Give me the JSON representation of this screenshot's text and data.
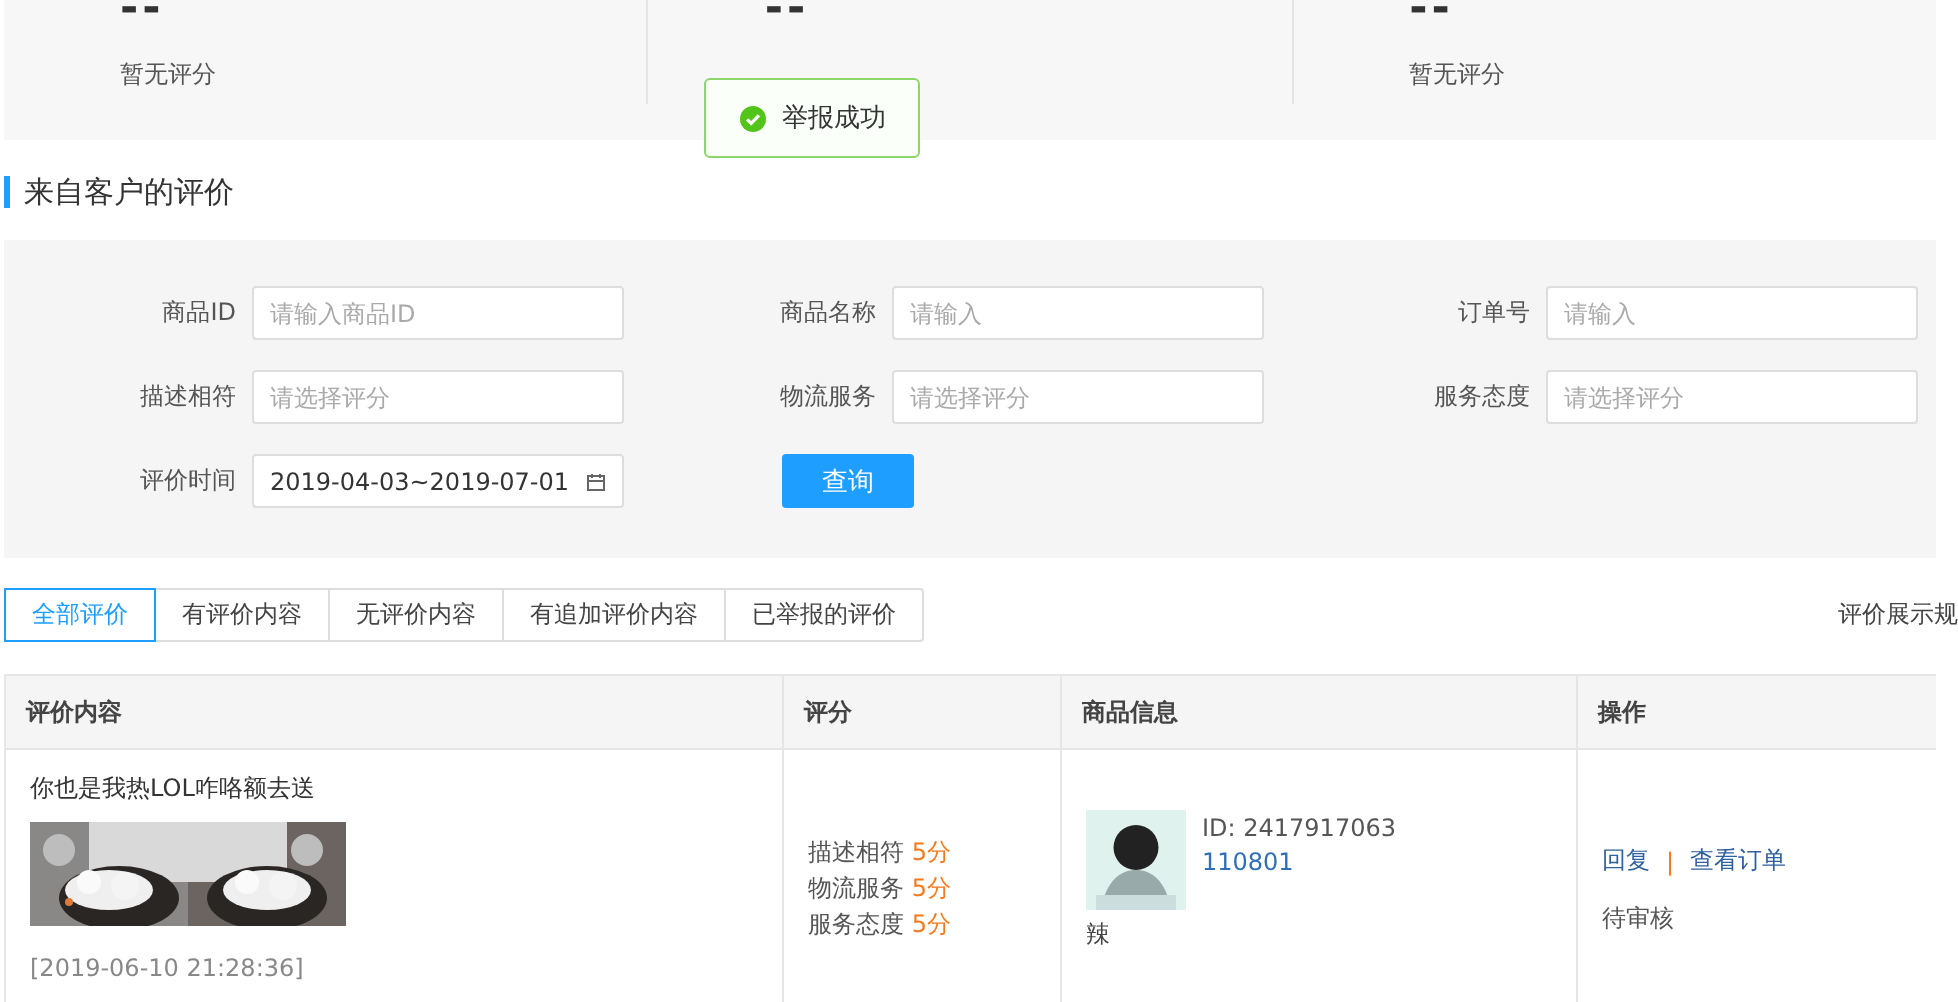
{
  "stats": [
    {
      "value": "--",
      "label": "暂无评分"
    },
    {
      "value": "--"
    },
    {
      "value": "--",
      "label": "暂无评分"
    }
  ],
  "toast": {
    "kind": "success",
    "text": "举报成功"
  },
  "section_title": "来自客户的评价",
  "filters": [
    {
      "kind": "text",
      "label": "商品ID",
      "placeholder": "请输入商品ID"
    },
    {
      "kind": "text",
      "label": "商品名称",
      "placeholder": "请输入"
    },
    {
      "kind": "text",
      "label": "订单号",
      "placeholder": "请输入"
    },
    {
      "kind": "select",
      "label": "描述相符",
      "placeholder": "请选择评分"
    },
    {
      "kind": "select",
      "label": "物流服务",
      "placeholder": "请选择评分"
    },
    {
      "kind": "select",
      "label": "服务态度",
      "placeholder": "请选择评分"
    },
    {
      "kind": "date",
      "label": "评价时间",
      "value": "2019-04-03~2019-07-01"
    }
  ],
  "query_button": "查询",
  "tabs": [
    {
      "label": "全部评价",
      "selected": true
    },
    {
      "label": "有评价内容",
      "selected": false
    },
    {
      "label": "无评价内容",
      "selected": false
    },
    {
      "label": "有追加评价内容",
      "selected": false
    },
    {
      "label": "已举报的评价",
      "selected": false
    }
  ],
  "rules_link": "评价展示规",
  "table": {
    "columns": [
      "评价内容",
      "评分",
      "商品信息",
      "操作"
    ],
    "rows": [
      {
        "comment": "你也是我热LOL咋咯额去送",
        "photos": [
          {
            "kind": "picture"
          },
          {
            "kind": "picture"
          }
        ],
        "time": "[2019-06-10 21:28:36]",
        "ratings": [
          {
            "label": "描述相符",
            "score": "5分"
          },
          {
            "label": "物流服务",
            "score": "5分"
          },
          {
            "label": "服务态度",
            "score": "5分"
          }
        ],
        "product": {
          "id": "ID: 2417917063",
          "code": "110801",
          "name": "辣"
        },
        "actions": [
          "回复",
          "查看订单"
        ],
        "action_separator": "|",
        "status": "待审核"
      }
    ]
  }
}
